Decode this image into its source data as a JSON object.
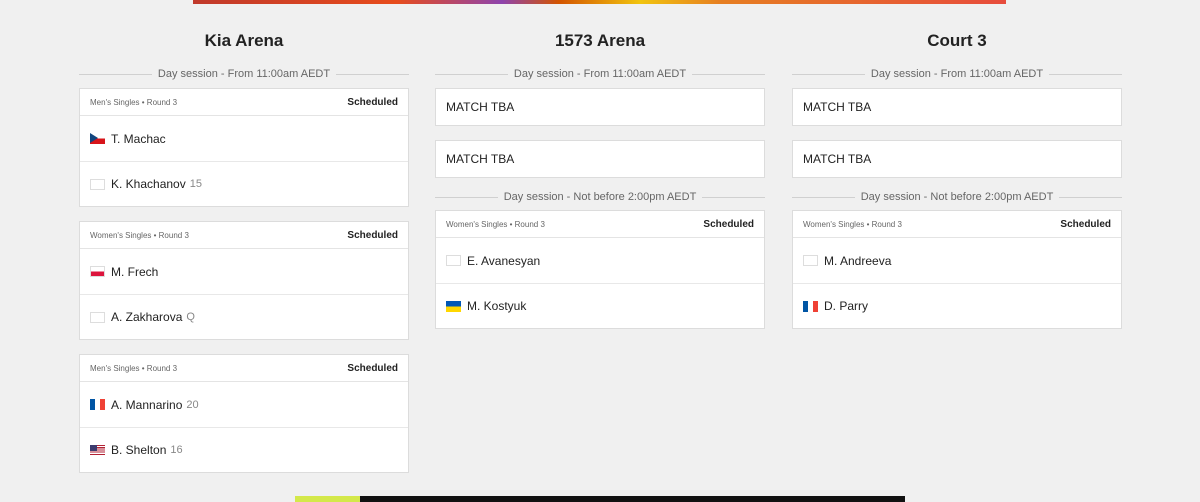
{
  "columns": [
    {
      "court": "Kia Arena",
      "session1": "Day session - From 11:00am AEDT",
      "matches": [
        {
          "round": "Men's Singles • Round 3",
          "status": "Scheduled",
          "p1": {
            "name": "T. Machac",
            "seed": "",
            "flag": "cz"
          },
          "p2": {
            "name": "K. Khachanov",
            "seed": "15",
            "flag": "blank"
          }
        },
        {
          "round": "Women's Singles • Round 3",
          "status": "Scheduled",
          "p1": {
            "name": "M. Frech",
            "seed": "",
            "flag": "pl"
          },
          "p2": {
            "name": "A. Zakharova",
            "seed": "Q",
            "flag": "blank"
          }
        },
        {
          "round": "Men's Singles • Round 3",
          "status": "Scheduled",
          "p1": {
            "name": "A. Mannarino",
            "seed": "20",
            "flag": "fr"
          },
          "p2": {
            "name": "B. Shelton",
            "seed": "16",
            "flag": "us"
          }
        }
      ]
    },
    {
      "court": "1573 Arena",
      "session1": "Day session - From 11:00am AEDT",
      "tba": [
        "MATCH TBA",
        "MATCH TBA"
      ],
      "session2": "Day session - Not before 2:00pm AEDT",
      "matches": [
        {
          "round": "Women's Singles • Round 3",
          "status": "Scheduled",
          "p1": {
            "name": "E. Avanesyan",
            "seed": "",
            "flag": "blank"
          },
          "p2": {
            "name": "M. Kostyuk",
            "seed": "",
            "flag": "ua"
          }
        }
      ]
    },
    {
      "court": "Court 3",
      "session1": "Day session - From 11:00am AEDT",
      "tba": [
        "MATCH TBA",
        "MATCH TBA"
      ],
      "session2": "Day session - Not before 2:00pm AEDT",
      "matches": [
        {
          "round": "Women's Singles • Round 3",
          "status": "Scheduled",
          "p1": {
            "name": "M. Andreeva",
            "seed": "",
            "flag": "blank"
          },
          "p2": {
            "name": "D. Parry",
            "seed": "",
            "flag": "fr"
          }
        }
      ]
    }
  ]
}
